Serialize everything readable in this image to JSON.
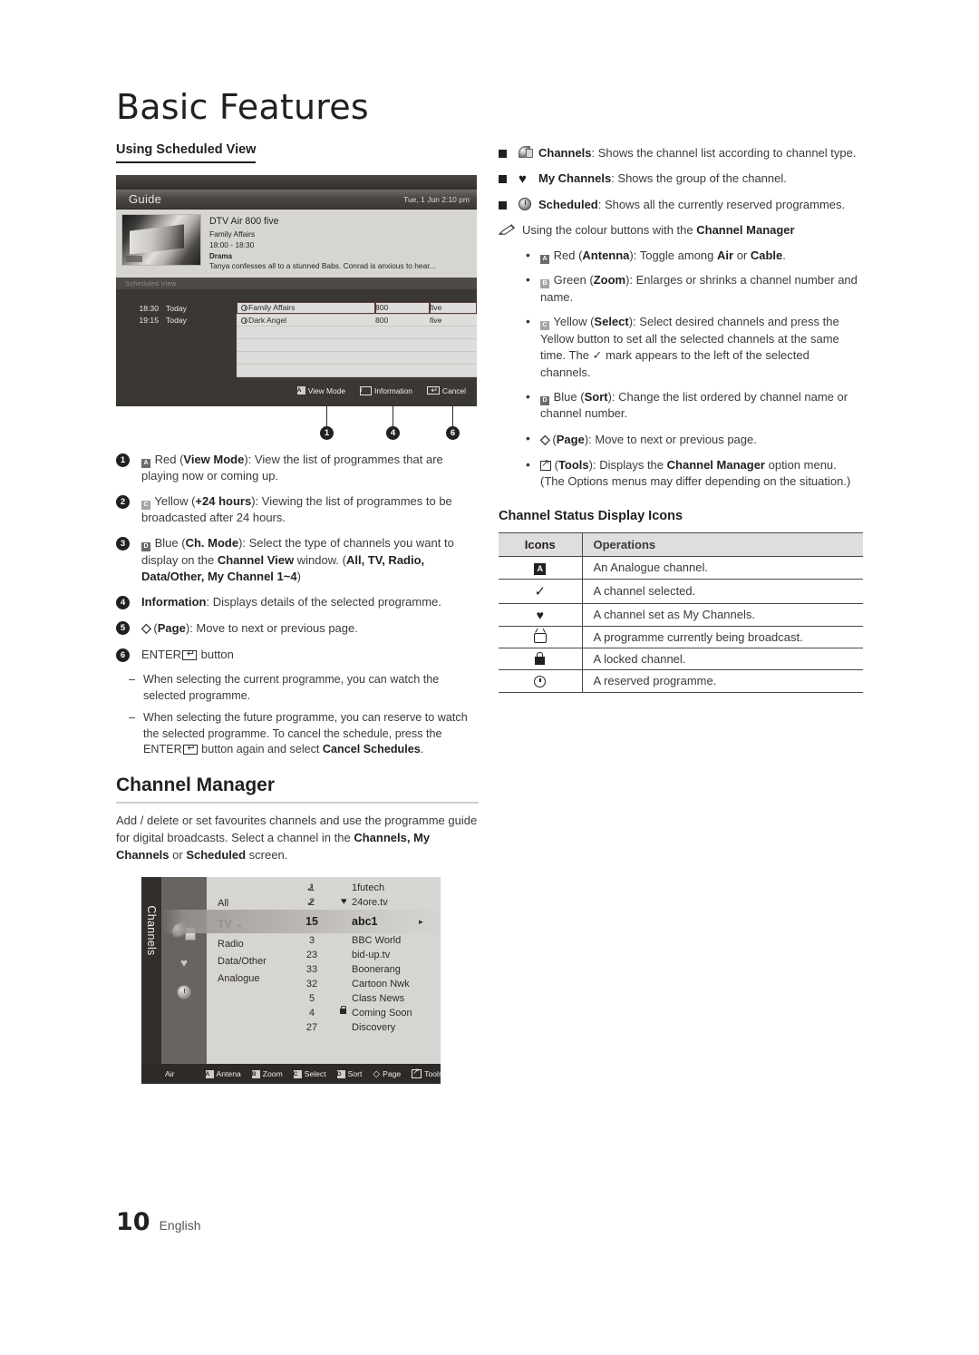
{
  "chapter_title": "Basic Features",
  "left": {
    "subhead": "Using Scheduled View",
    "guide": {
      "title": "Guide",
      "date": "Tue, 1 Jun 2:10 pm",
      "info": {
        "channel": "DTV Air 800 five",
        "programme": "Family Affairs",
        "time": "18:00 - 18:30",
        "genre": "Drama",
        "synopsis": "Tanya confesses all to a stunned Babs. Conrad is anxious to hear..."
      },
      "section_label": "Scheduled View",
      "rows": [
        {
          "time": "18:30",
          "day": "Today",
          "programme": "Family Affairs",
          "number": "800",
          "channel": "five"
        },
        {
          "time": "19:15",
          "day": "Today",
          "programme": "Dark Angel",
          "number": "800",
          "channel": "five"
        }
      ],
      "empty_rows": 4,
      "footbar": [
        {
          "key": "A",
          "label": "View Mode"
        },
        {
          "key": "i",
          "label": "Information"
        },
        {
          "key": "enter",
          "label": "Cancel"
        }
      ]
    },
    "callouts": [
      "1",
      "4",
      "6"
    ],
    "items": [
      {
        "n": "1",
        "html": "<span class=\"key-ltsq dk\">A</span> Red (<b>View Mode</b>): View the list of programmes that are playing now or coming up."
      },
      {
        "n": "2",
        "html": "<span class=\"key-ltsq\">C</span> Yellow (<b>+24 hours</b>): Viewing the list of programmes to be broadcasted after 24 hours."
      },
      {
        "n": "3",
        "html": "<span class=\"key-ltsq dk\">D</span> Blue (<b>Ch. Mode</b>): Select the type of channels you want to display on the <b>Channel View</b> window. (<b>All, TV, Radio, Data/Other, My Channel 1~4</b>)"
      },
      {
        "n": "4",
        "html": "<b>Information</b>: Displays details of the selected programme."
      },
      {
        "n": "5",
        "html": "<span class=\"updown\">◇</span> (<b>Page</b>): Move to next or previous page."
      },
      {
        "n": "6",
        "html": "ENTER<span class=\"key-enter-b\"></span> button"
      }
    ],
    "subitems": [
      "When selecting the current programme, you can watch the selected programme.",
      "When selecting the future programme, you can reserve to watch the selected programme. To cancel the schedule, press the ENTER<span class=\"key-enter-b\"></span> button again and select <b>Cancel Schedules</b>."
    ],
    "section": {
      "title": "Channel Manager",
      "body": "Add / delete or set favourites channels and use the programme guide for digital broadcasts. Select a channel in the <b>Channels, My Channels</b> or <b>Scheduled</b> screen."
    },
    "cm": {
      "tab_label": "Channels",
      "groups": [
        "All",
        "TV",
        "Radio",
        "Data/Other",
        "Analogue"
      ],
      "selected_group": "TV",
      "rows": [
        {
          "num": "1",
          "name": "1futech",
          "check": true,
          "heart": false,
          "lock": false
        },
        {
          "num": "2",
          "name": "24ore.tv",
          "check": true,
          "heart": true,
          "lock": false
        },
        {
          "num": "3",
          "name": "BBC World",
          "check": false,
          "heart": false,
          "lock": false
        },
        {
          "num": "23",
          "name": "bid-up.tv",
          "check": false,
          "heart": false,
          "lock": false
        },
        {
          "num": "33",
          "name": "Boonerang",
          "check": false,
          "heart": false,
          "lock": false
        },
        {
          "num": "32",
          "name": "Cartoon Nwk",
          "check": false,
          "heart": false,
          "lock": false
        },
        {
          "num": "5",
          "name": "Class News",
          "check": false,
          "heart": false,
          "lock": false
        },
        {
          "num": "4",
          "name": "Coming Soon",
          "check": false,
          "heart": false,
          "lock": true
        },
        {
          "num": "27",
          "name": "Discovery",
          "check": false,
          "heart": false,
          "lock": false
        }
      ],
      "selected_row": {
        "num": "15",
        "name": "abc1"
      },
      "foot": {
        "source": "Air",
        "buttons": [
          {
            "key": "A",
            "label": "Antena"
          },
          {
            "key": "B",
            "label": "Zoom"
          },
          {
            "key": "C",
            "label": "Select"
          },
          {
            "key": "D",
            "label": "Sort"
          },
          {
            "key": "page",
            "label": "Page"
          },
          {
            "key": "tools",
            "label": "Tools"
          }
        ]
      }
    }
  },
  "right": {
    "bullets": [
      {
        "icon": "satellite-dish-icon",
        "html": "<b>Channels</b>: Shows the channel list according to channel type."
      },
      {
        "icon": "heart-icon",
        "html": "<b>My Channels</b>: Shows the group of the channel."
      },
      {
        "icon": "clock-icon",
        "html": "<b>Scheduled</b>: Shows all the currently reserved programmes."
      }
    ],
    "note": "Using the colour buttons with the <b>Channel Manager</b>",
    "dots": [
      "<span class=\"key-ltsq dk\">A</span> Red (<b>Antenna</b>): Toggle among <b>Air</b> or <b>Cable</b>.",
      "<span class=\"key-ltsq\">B</span> Green (<b>Zoom</b>): Enlarges or shrinks a channel number and name.",
      "<span class=\"key-ltsq\">C</span> Yellow (<b>Select</b>): Select desired channels and press the Yellow button to set all the selected channels at the same time. The ✓ mark appears to the left of the selected channels.",
      "<span class=\"key-ltsq dk\">D</span> Blue (<b>Sort</b>): Change the list ordered by channel name or channel number.",
      "<span class=\"updown\">◇</span> (<b>Page</b>): Move to next or previous page.",
      "<span class=\"tools-ic-dark\"></span> (<b>Tools</b>): Displays the <b>Channel Manager</b> option menu. (The Options menus may differ depending on the situation.)"
    ],
    "table": {
      "title": "Channel Status Display Icons",
      "headers": [
        "Icons",
        "Operations"
      ],
      "rows": [
        {
          "icon": "analogue-a-icon",
          "text": "An Analogue channel."
        },
        {
          "icon": "check-icon",
          "text": "A channel selected."
        },
        {
          "icon": "heart-icon",
          "text": "A channel set as My Channels."
        },
        {
          "icon": "tv-icon",
          "text": "A programme currently being broadcast."
        },
        {
          "icon": "lock-icon",
          "text": "A locked channel."
        },
        {
          "icon": "clock-icon",
          "text": "A reserved programme."
        }
      ]
    }
  },
  "footer": {
    "page": "10",
    "language": "English"
  }
}
